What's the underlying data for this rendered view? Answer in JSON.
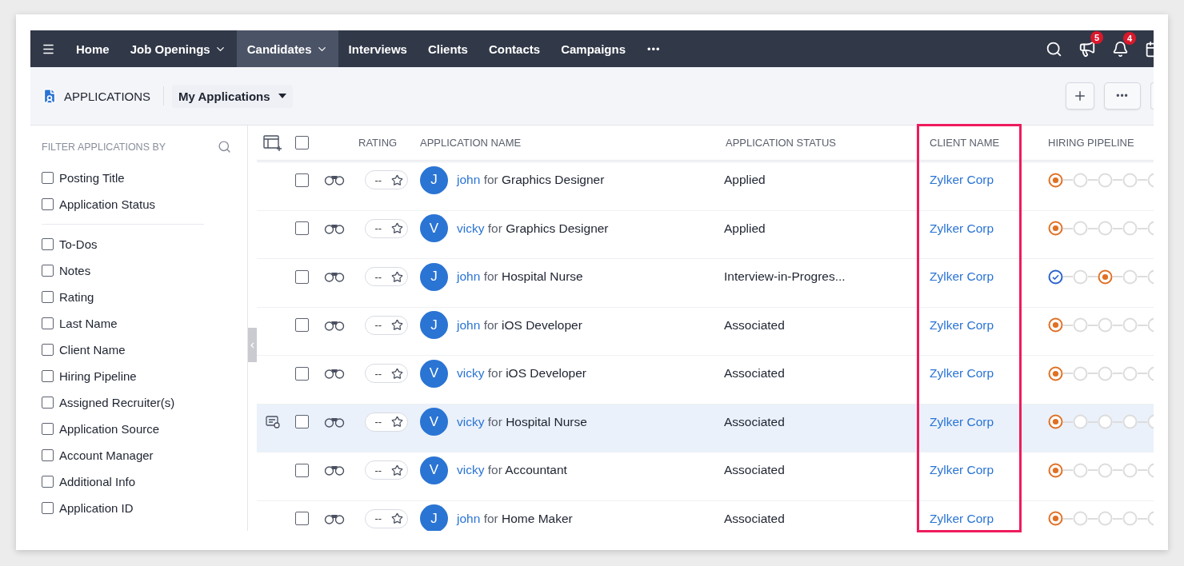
{
  "nav": {
    "items": [
      {
        "label": "Home",
        "selected": false,
        "dropdown": false
      },
      {
        "label": "Job Openings",
        "selected": false,
        "dropdown": true
      },
      {
        "label": "Candidates",
        "selected": true,
        "dropdown": true
      },
      {
        "label": "Interviews",
        "selected": false,
        "dropdown": false
      },
      {
        "label": "Clients",
        "selected": false,
        "dropdown": false
      },
      {
        "label": "Contacts",
        "selected": false,
        "dropdown": false
      },
      {
        "label": "Campaigns",
        "selected": false,
        "dropdown": false
      }
    ],
    "more": "•••",
    "announcements_badge": "5",
    "notifications_badge": "4"
  },
  "header": {
    "module": "APPLICATIONS",
    "view": "My Applications",
    "more": "•••"
  },
  "sidebar": {
    "title": "FILTER APPLICATIONS BY",
    "groups": [
      [
        {
          "label": "Posting Title",
          "checked": false
        },
        {
          "label": "Application Status",
          "checked": false
        }
      ],
      [
        {
          "label": "To-Dos",
          "checked": false
        },
        {
          "label": "Notes",
          "checked": false
        },
        {
          "label": "Rating",
          "checked": false
        },
        {
          "label": "Last Name",
          "checked": false
        },
        {
          "label": "Client Name",
          "checked": false
        },
        {
          "label": "Hiring Pipeline",
          "checked": false
        },
        {
          "label": "Assigned Recruiter(s)",
          "checked": false
        },
        {
          "label": "Application Source",
          "checked": false
        },
        {
          "label": "Account Manager",
          "checked": false
        },
        {
          "label": "Additional Info",
          "checked": false
        },
        {
          "label": "Application ID",
          "checked": false
        }
      ]
    ]
  },
  "table": {
    "select_all_checked": false,
    "columns": [
      {
        "label": "RATING"
      },
      {
        "label": "APPLICATION NAME"
      },
      {
        "label": "APPLICATION STATUS"
      },
      {
        "label": "CLIENT NAME",
        "highlighted": true
      },
      {
        "label": "HIRING PIPELINE"
      }
    ],
    "rows": [
      {
        "selected": false,
        "has_note": false,
        "checked": false,
        "rating": "--",
        "initial": "J",
        "candidate": "john",
        "connector": "for",
        "job": "Graphics Designer",
        "status": "Applied",
        "client": "Zylker Corp",
        "pipeline": [
          {
            "kind": "current"
          },
          {
            "kind": "pending"
          },
          {
            "kind": "pending"
          },
          {
            "kind": "pending"
          },
          {
            "kind": "pending"
          }
        ]
      },
      {
        "selected": false,
        "has_note": false,
        "checked": false,
        "rating": "--",
        "initial": "V",
        "candidate": "vicky",
        "connector": "for",
        "job": "Graphics Designer",
        "status": "Applied",
        "client": "Zylker Corp",
        "pipeline": [
          {
            "kind": "current"
          },
          {
            "kind": "pending"
          },
          {
            "kind": "pending"
          },
          {
            "kind": "pending"
          },
          {
            "kind": "pending"
          }
        ]
      },
      {
        "selected": false,
        "has_note": false,
        "checked": false,
        "rating": "--",
        "initial": "J",
        "candidate": "john",
        "connector": "for",
        "job": "Hospital Nurse",
        "status": "Interview-in-Progres...",
        "client": "Zylker Corp",
        "pipeline": [
          {
            "kind": "done"
          },
          {
            "kind": "pending"
          },
          {
            "kind": "current"
          },
          {
            "kind": "pending"
          },
          {
            "kind": "pending"
          }
        ]
      },
      {
        "selected": false,
        "has_note": false,
        "checked": false,
        "rating": "--",
        "initial": "J",
        "candidate": "john",
        "connector": "for",
        "job": "iOS Developer",
        "status": "Associated",
        "client": "Zylker Corp",
        "pipeline": [
          {
            "kind": "current"
          },
          {
            "kind": "pending"
          },
          {
            "kind": "pending"
          },
          {
            "kind": "pending"
          },
          {
            "kind": "pending"
          }
        ]
      },
      {
        "selected": false,
        "has_note": false,
        "checked": false,
        "rating": "--",
        "initial": "V",
        "candidate": "vicky",
        "connector": "for",
        "job": "iOS Developer",
        "status": "Associated",
        "client": "Zylker Corp",
        "pipeline": [
          {
            "kind": "current"
          },
          {
            "kind": "pending"
          },
          {
            "kind": "pending"
          },
          {
            "kind": "pending"
          },
          {
            "kind": "pending"
          }
        ]
      },
      {
        "selected": true,
        "has_note": true,
        "checked": false,
        "rating": "--",
        "initial": "V",
        "candidate": "vicky",
        "connector": "for",
        "job": "Hospital Nurse",
        "status": "Associated",
        "client": "Zylker Corp",
        "pipeline": [
          {
            "kind": "current"
          },
          {
            "kind": "pending"
          },
          {
            "kind": "pending"
          },
          {
            "kind": "pending"
          },
          {
            "kind": "pending"
          }
        ]
      },
      {
        "selected": false,
        "has_note": false,
        "checked": false,
        "rating": "--",
        "initial": "V",
        "candidate": "vicky",
        "connector": "for",
        "job": "Accountant",
        "status": "Associated",
        "client": "Zylker Corp",
        "pipeline": [
          {
            "kind": "current"
          },
          {
            "kind": "pending"
          },
          {
            "kind": "pending"
          },
          {
            "kind": "pending"
          },
          {
            "kind": "pending"
          }
        ]
      },
      {
        "selected": false,
        "has_note": false,
        "checked": false,
        "rating": "--",
        "initial": "J",
        "candidate": "john",
        "connector": "for",
        "job": "Home Maker",
        "status": "Associated",
        "client": "Zylker Corp",
        "pipeline": [
          {
            "kind": "current"
          },
          {
            "kind": "pending"
          },
          {
            "kind": "pending"
          },
          {
            "kind": "pending"
          },
          {
            "kind": "pending"
          }
        ]
      }
    ]
  }
}
